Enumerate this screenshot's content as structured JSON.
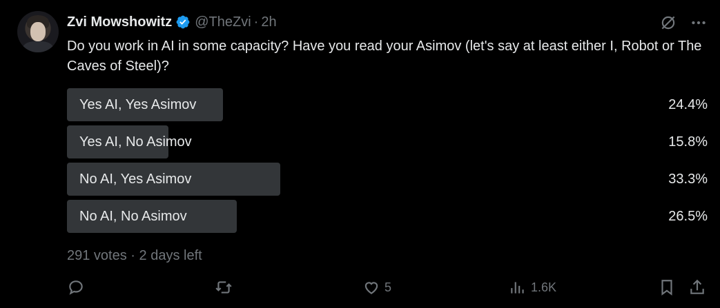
{
  "tweet": {
    "author_name": "Zvi Mowshowitz",
    "handle": "@TheZvi",
    "separator": "·",
    "time": "2h",
    "question": "Do you work in AI in some capacity? Have you read your Asimov (let's say at least either I, Robot or The Caves of Steel)?"
  },
  "poll": {
    "options": [
      {
        "label": "Yes AI, Yes Asimov",
        "percent_text": "24.4%",
        "percent": 24.4
      },
      {
        "label": "Yes AI, No Asimov",
        "percent_text": "15.8%",
        "percent": 15.8
      },
      {
        "label": "No AI, Yes Asimov",
        "percent_text": "33.3%",
        "percent": 33.3
      },
      {
        "label": "No AI, No Asimov",
        "percent_text": "26.5%",
        "percent": 26.5
      }
    ],
    "votes": "291 votes",
    "separator": "·",
    "remaining": "2 days left"
  },
  "actions": {
    "likes": "5",
    "views": "1.6K"
  },
  "icons": {
    "verified": "verified-badge-icon",
    "grok": "grok-icon",
    "more": "more-icon",
    "reply": "reply-icon",
    "retweet": "retweet-icon",
    "like": "like-icon",
    "views": "views-icon",
    "bookmark": "bookmark-icon",
    "share": "share-icon"
  },
  "colors": {
    "background": "#000000",
    "text": "#e7e9ea",
    "muted": "#71767b",
    "poll_fill": "#333639",
    "verified": "#1d9bf0"
  }
}
